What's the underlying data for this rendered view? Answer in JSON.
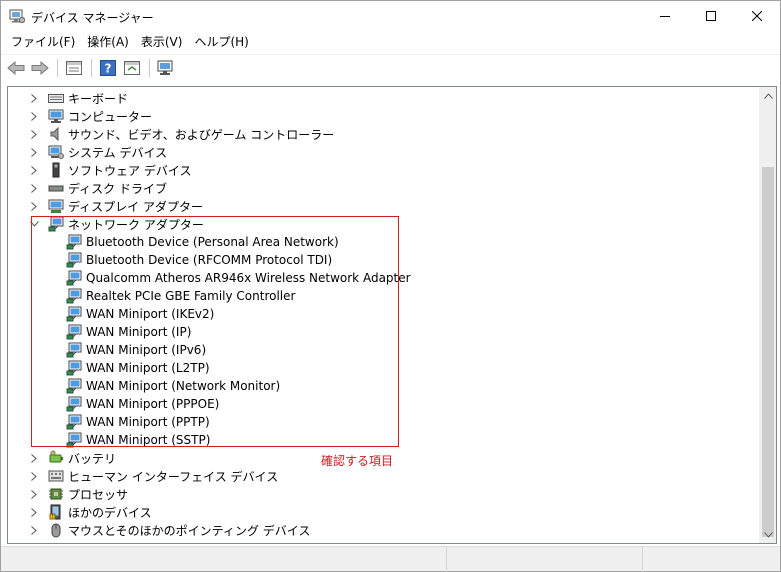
{
  "window": {
    "title": "デバイス マネージャー"
  },
  "menu": [
    {
      "label": "ファイル(F)"
    },
    {
      "label": "操作(A)"
    },
    {
      "label": "表示(V)"
    },
    {
      "label": "ヘルプ(H)"
    }
  ],
  "toolbar": {
    "icons": [
      "back-arrow-icon",
      "forward-arrow-icon",
      "properties-icon",
      "help-icon",
      "update-driver-icon",
      "scan-hardware-icon"
    ]
  },
  "tree": {
    "categories": [
      {
        "label": "キーボード",
        "icon": "keyboard-icon",
        "expanded": false
      },
      {
        "label": "コンピューター",
        "icon": "computer-icon",
        "expanded": false
      },
      {
        "label": "サウンド、ビデオ、およびゲーム コントローラー",
        "icon": "speaker-icon",
        "expanded": false
      },
      {
        "label": "システム デバイス",
        "icon": "system-device-icon",
        "expanded": false
      },
      {
        "label": "ソフトウェア デバイス",
        "icon": "software-device-icon",
        "expanded": false
      },
      {
        "label": "ディスク ドライブ",
        "icon": "disk-drive-icon",
        "expanded": false
      },
      {
        "label": "ディスプレイ アダプター",
        "icon": "display-adapter-icon",
        "expanded": false
      },
      {
        "label": "ネットワーク アダプター",
        "icon": "network-adapter-icon",
        "expanded": true
      },
      {
        "label": "バッテリ",
        "icon": "battery-icon",
        "expanded": false
      },
      {
        "label": "ヒューマン インターフェイス デバイス",
        "icon": "hid-icon",
        "expanded": false
      },
      {
        "label": "プロセッサ",
        "icon": "processor-icon",
        "expanded": false
      },
      {
        "label": "ほかのデバイス",
        "icon": "other-device-icon",
        "expanded": false
      },
      {
        "label": "マウスとそのほかのポインティング デバイス",
        "icon": "mouse-icon",
        "expanded": false
      }
    ],
    "network_adapters": [
      "Bluetooth Device (Personal Area Network)",
      "Bluetooth Device (RFCOMM Protocol TDI)",
      "Qualcomm Atheros AR946x Wireless Network Adapter",
      "Realtek PCIe GBE Family Controller",
      "WAN Miniport (IKEv2)",
      "WAN Miniport (IP)",
      "WAN Miniport (IPv6)",
      "WAN Miniport (L2TP)",
      "WAN Miniport (Network Monitor)",
      "WAN Miniport (PPPOE)",
      "WAN Miniport (PPTP)",
      "WAN Miniport (SSTP)"
    ]
  },
  "annotation": {
    "text": "確認する項目",
    "color": "#c31f1f"
  }
}
